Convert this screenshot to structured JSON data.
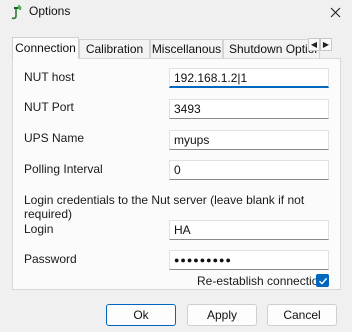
{
  "window": {
    "title": "Options",
    "app_icon": "leaf-plug-icon",
    "close_icon": "close-icon"
  },
  "tabs": [
    {
      "label": "Connection",
      "active": true
    },
    {
      "label": "Calibration",
      "active": false
    },
    {
      "label": "Miscellanous",
      "active": false
    },
    {
      "label": "Shutdown Options",
      "active": false
    }
  ],
  "tab_scroll": {
    "left_icon": "arrow-left-icon",
    "right_icon": "arrow-right-icon",
    "left_glyph": "◀",
    "right_glyph": "▶"
  },
  "connection": {
    "nut_host": {
      "label": "NUT host",
      "value": "192.168.1.2|1"
    },
    "nut_port": {
      "label": "NUT Port",
      "value": "3493"
    },
    "ups_name": {
      "label": "UPS Name",
      "value": "myups"
    },
    "polling_interval": {
      "label": "Polling Interval",
      "value": "0"
    },
    "login_note": "Login credentials to the Nut server (leave blank if not required)",
    "login": {
      "label": "Login",
      "value": "HA"
    },
    "password": {
      "label": "Password",
      "value": "●●●●●●●●●"
    },
    "reestablish": {
      "label": "Re-establish connection",
      "checked": true
    }
  },
  "buttons": {
    "ok": "Ok",
    "apply": "Apply",
    "cancel": "Cancel"
  },
  "colors": {
    "accent": "#0067c0",
    "window_bg": "#f0f0f0",
    "panel_bg": "#fbfbfb"
  }
}
